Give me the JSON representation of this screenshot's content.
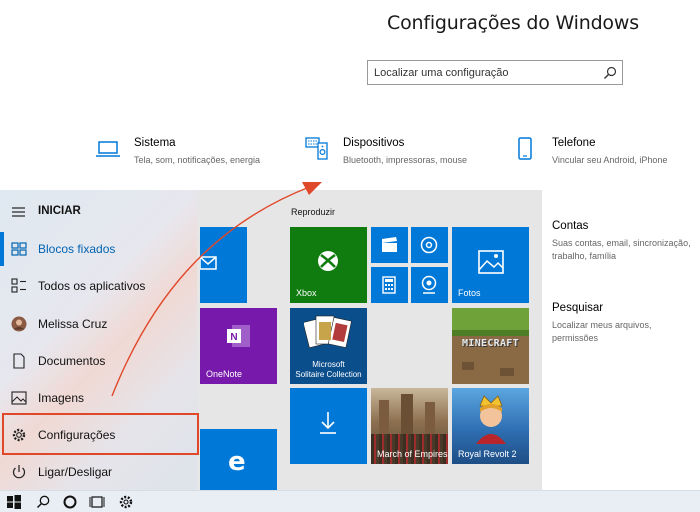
{
  "settings": {
    "title": "Configurações do Windows",
    "search_placeholder": "Localizar uma configuração",
    "categories": [
      {
        "name": "Sistema",
        "desc": "Tela, som, notificações, energia"
      },
      {
        "name": "Dispositivos",
        "desc": "Bluetooth, impressoras, mouse"
      },
      {
        "name": "Telefone",
        "desc": "Vincular seu Android, iPhone"
      },
      {
        "name": "Contas",
        "desc": "Suas contas, email, sincronização, trabalho, família"
      },
      {
        "name": "Pesquisar",
        "desc": "Localizar meus arquivos, permissões"
      }
    ]
  },
  "start": {
    "header": "INICIAR",
    "nav": [
      {
        "label": "Blocos fixados"
      },
      {
        "label": "Todos os aplicativos"
      },
      {
        "label": "Melissa Cruz"
      },
      {
        "label": "Documentos"
      },
      {
        "label": "Imagens"
      },
      {
        "label": "Configurações"
      },
      {
        "label": "Ligar/Desligar"
      }
    ],
    "group_label": "Reproduzir",
    "tiles": {
      "xbox": "Xbox",
      "fotos": "Fotos",
      "onenote": "OneNote",
      "solitaire_line1": "Microsoft",
      "solitaire_line2": "Solitaire Collection",
      "march": "March of Empires",
      "royal": "Royal Revolt 2",
      "minecraft": "MINECRAFT"
    }
  },
  "colors": {
    "accent": "#0078d7",
    "tile_green": "#107c10",
    "onenote": "#7719aa",
    "highlight": "#e0482a"
  },
  "icons": {
    "taskbar": [
      "windows-logo-icon",
      "search-icon",
      "cortana-icon",
      "task-view-icon",
      "settings-gear-icon"
    ]
  }
}
